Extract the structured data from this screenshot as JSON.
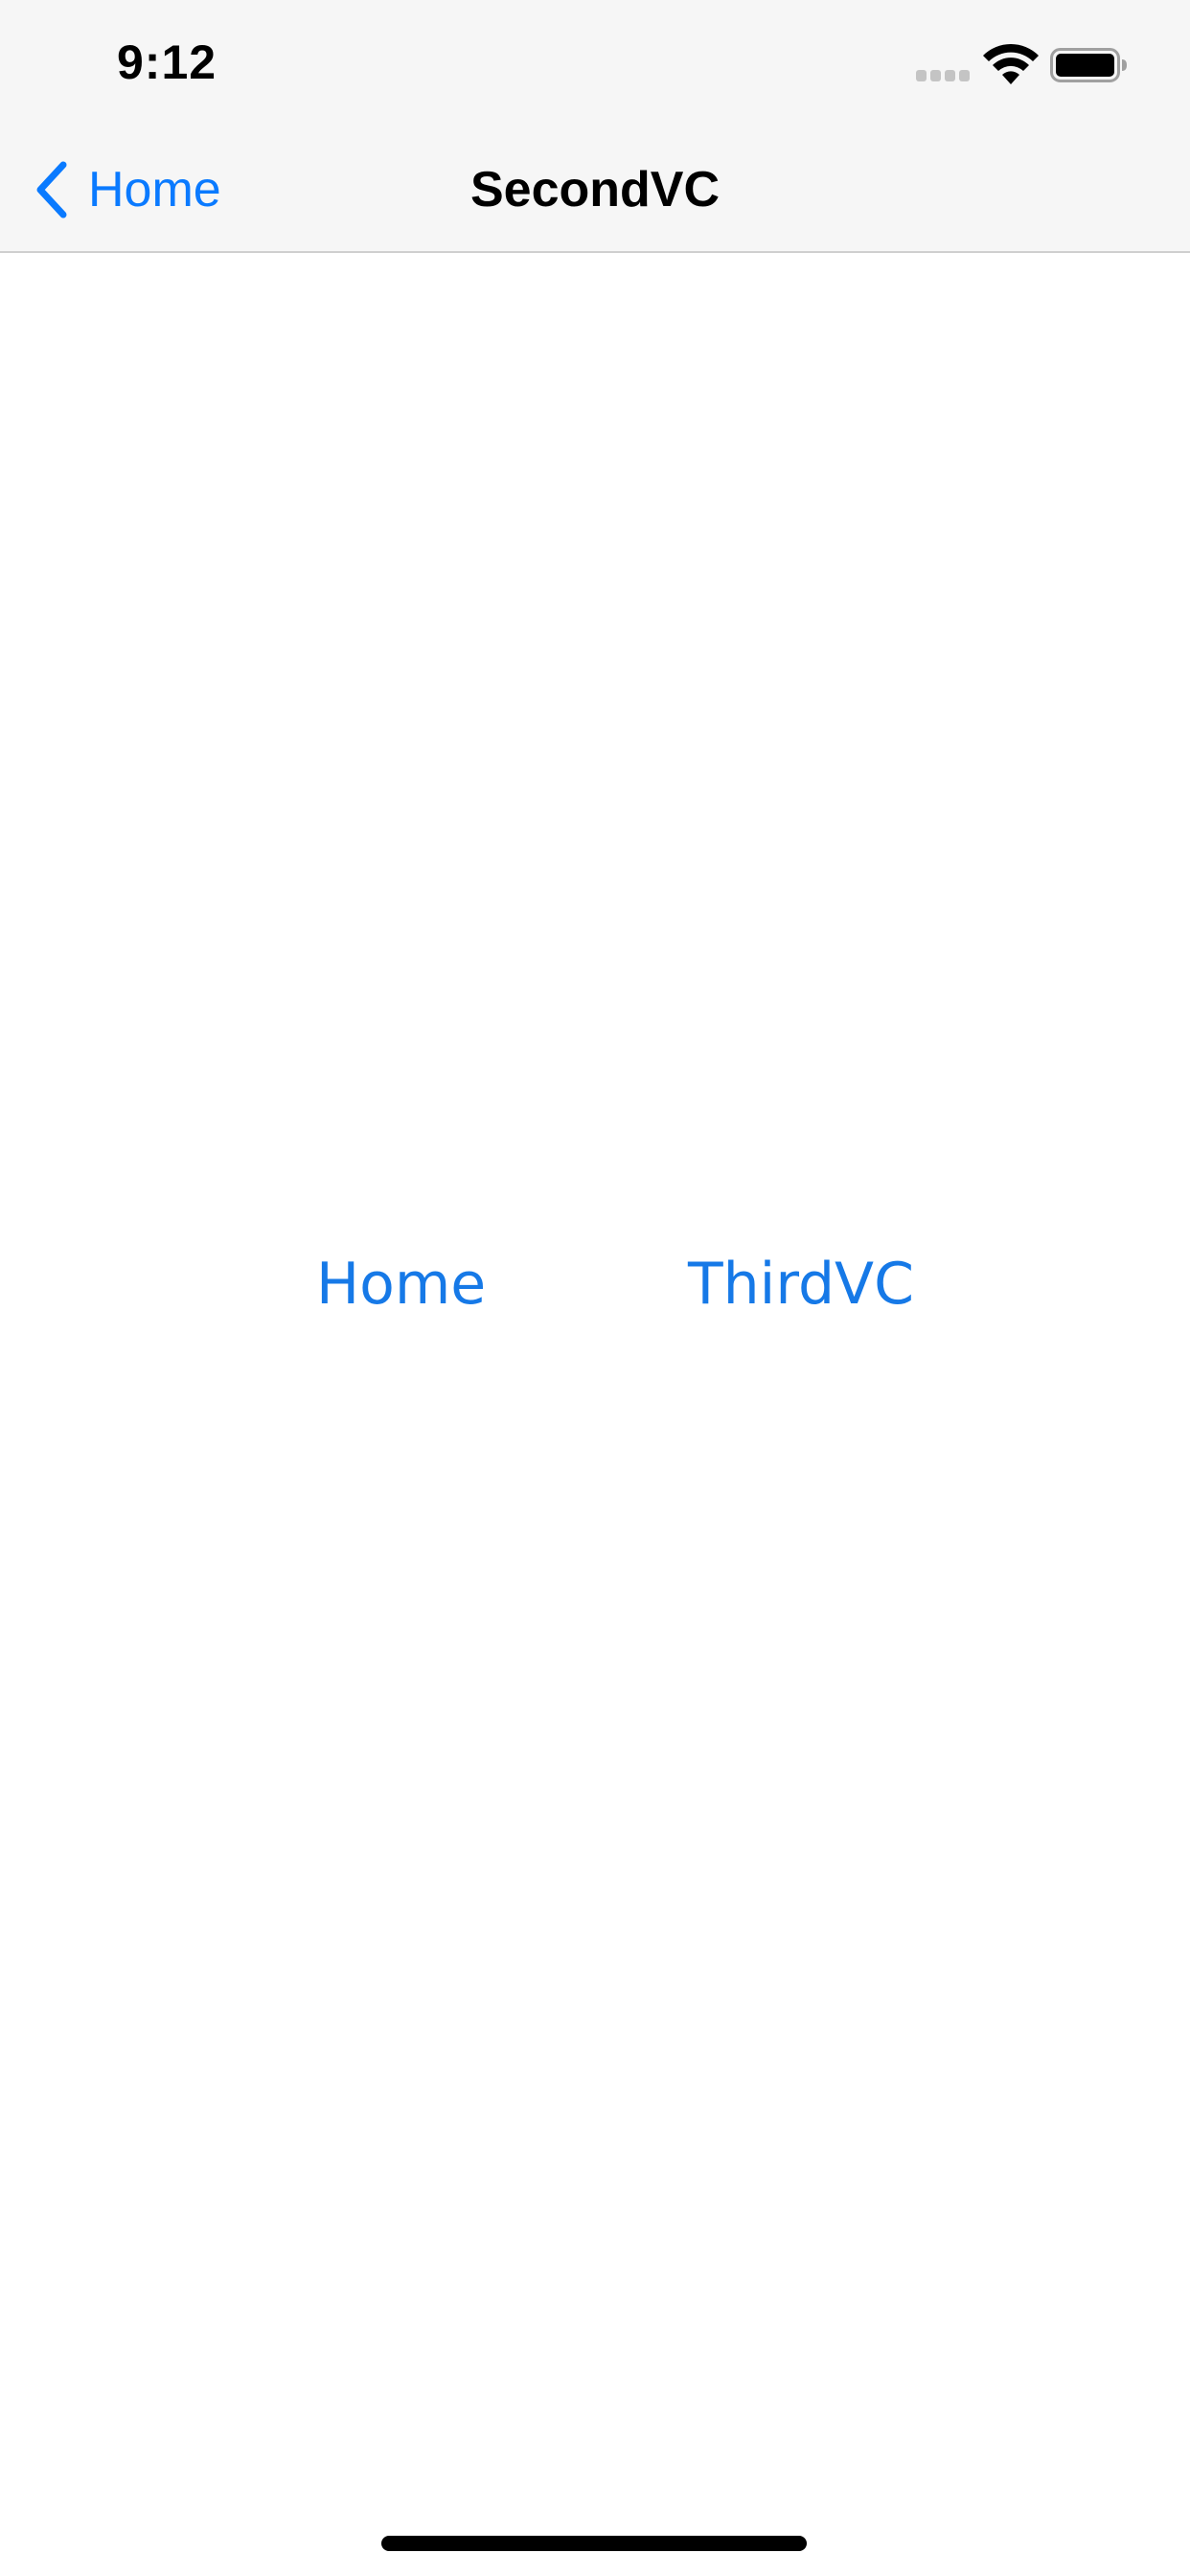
{
  "status_bar": {
    "time": "9:12",
    "signal_icon": "cellular-signal-icon",
    "wifi_icon": "wifi-icon",
    "battery_icon": "battery-icon"
  },
  "nav_bar": {
    "back_label": "Home",
    "back_icon": "chevron-left-icon",
    "title": "SecondVC",
    "accent_color": "#0a7aff"
  },
  "main": {
    "home_button_label": "Home",
    "third_button_label": "ThirdVC",
    "button_color": "#1679e7"
  }
}
